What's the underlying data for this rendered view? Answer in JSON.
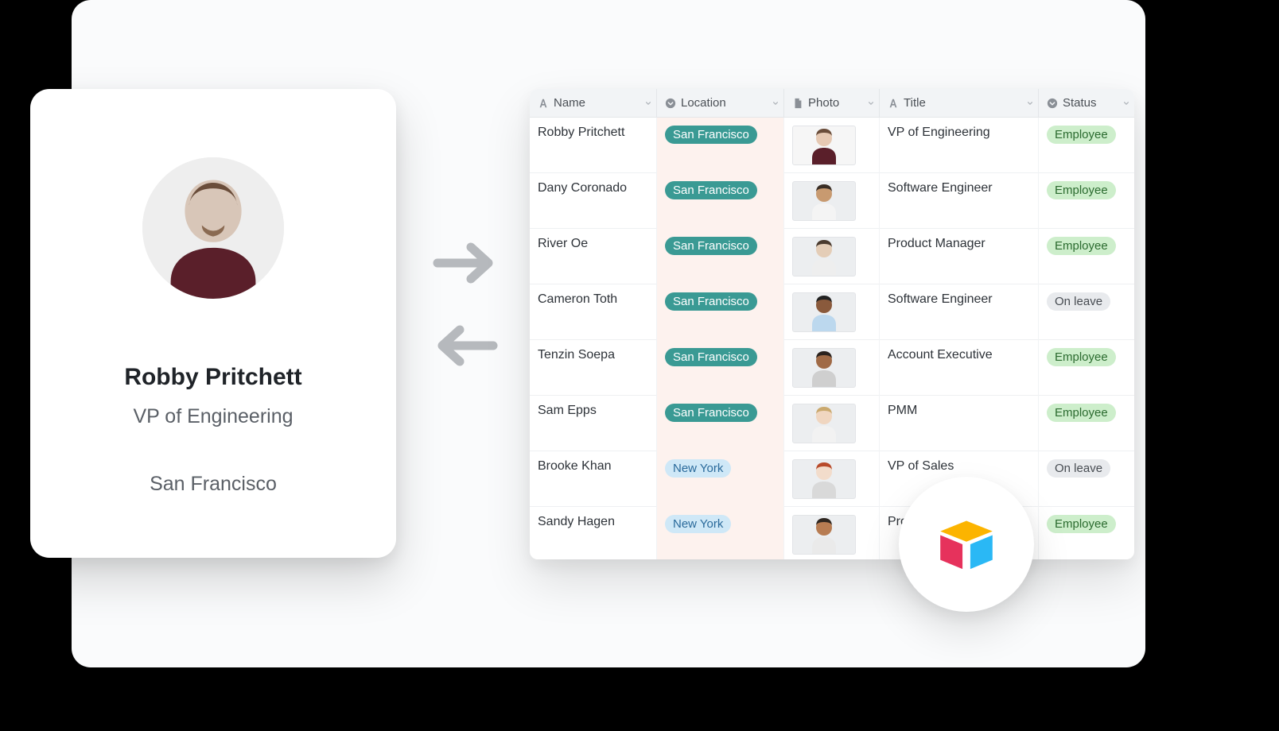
{
  "profile": {
    "name": "Robby Pritchett",
    "title": "VP of Engineering",
    "location": "San Francisco"
  },
  "table": {
    "columns": [
      {
        "label": "Name",
        "icon": "text"
      },
      {
        "label": "Location",
        "icon": "select"
      },
      {
        "label": "Photo",
        "icon": "attachment"
      },
      {
        "label": "Title",
        "icon": "text"
      },
      {
        "label": "Status",
        "icon": "select"
      }
    ],
    "locations": {
      "sf": {
        "label": "San Francisco",
        "color": "#3a9a94",
        "text": "#ffffff"
      },
      "ny": {
        "label": "New York",
        "color": "#cfe8f7",
        "text": "#2a6a9b"
      }
    },
    "statuses": {
      "employee": {
        "label": "Employee",
        "color": "#cdeecb",
        "text": "#2b6b2f"
      },
      "onleave": {
        "label": "On leave",
        "color": "#e8eaed",
        "text": "#474c52"
      }
    },
    "rows": [
      {
        "name": "Robby Pritchett",
        "location": "sf",
        "title": "VP of Engineering",
        "status": "employee"
      },
      {
        "name": "Dany Coronado",
        "location": "sf",
        "title": "Software Engineer",
        "status": "employee"
      },
      {
        "name": "River Oe",
        "location": "sf",
        "title": "Product Manager",
        "status": "employee"
      },
      {
        "name": "Cameron Toth",
        "location": "sf",
        "title": "Software Engineer",
        "status": "onleave"
      },
      {
        "name": "Tenzin Soepa",
        "location": "sf",
        "title": "Account Executive",
        "status": "employee"
      },
      {
        "name": "Sam Epps",
        "location": "sf",
        "title": "PMM",
        "status": "employee"
      },
      {
        "name": "Brooke Khan",
        "location": "ny",
        "title": "VP of Sales",
        "status": "onleave"
      },
      {
        "name": "Sandy Hagen",
        "location": "ny",
        "title": "Pro",
        "status": "employee"
      }
    ]
  }
}
